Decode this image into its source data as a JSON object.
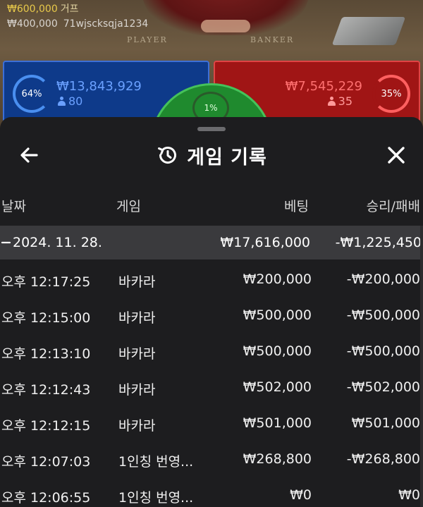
{
  "game": {
    "balance": "₩600,000",
    "balance_unit": "거프",
    "bet_amount": "₩400,000",
    "username": "71wjscksqja1234",
    "player_label": "PLAYER",
    "banker_label": "BANKER",
    "player_panel": {
      "percent": "64%",
      "amount": "₩13,843,929",
      "count": "80",
      "color": "#0e3a8a"
    },
    "banker_panel": {
      "percent": "35%",
      "amount": "₩7,545,229",
      "count": "35",
      "color": "#a01515"
    },
    "tie_percent": "1%"
  },
  "sheet": {
    "title": "게임 기록",
    "icons": {
      "back": "arrow-left-icon",
      "history": "history-clock-icon",
      "close": "close-icon"
    },
    "columns": {
      "date": "날짜",
      "game": "게임",
      "bet": "베팅",
      "win_loss": "승리/패배"
    },
    "date_group": {
      "date": "2024. 11. 28.",
      "total_bet": "₩17,616,000",
      "total_win_loss": "-₩1,225,450"
    },
    "rows": [
      {
        "time": "오후 12:17:25",
        "game": "바카라",
        "bet": "₩200,000",
        "win_loss": "-₩200,000"
      },
      {
        "time": "오후 12:15:00",
        "game": "바카라",
        "bet": "₩500,000",
        "win_loss": "-₩500,000"
      },
      {
        "time": "오후 12:13:10",
        "game": "바카라",
        "bet": "₩500,000",
        "win_loss": "-₩500,000"
      },
      {
        "time": "오후 12:12:43",
        "game": "바카라",
        "bet": "₩502,000",
        "win_loss": "-₩502,000"
      },
      {
        "time": "오후 12:12:15",
        "game": "바카라",
        "bet": "₩501,000",
        "win_loss": "₩501,000"
      },
      {
        "time": "오후 12:07:03",
        "game": "1인칭 번영...",
        "bet": "₩268,800",
        "win_loss": "-₩268,800"
      },
      {
        "time": "오후 12:06:55",
        "game": "1인칭 번영...",
        "bet": "₩0",
        "win_loss": "₩0"
      }
    ]
  }
}
